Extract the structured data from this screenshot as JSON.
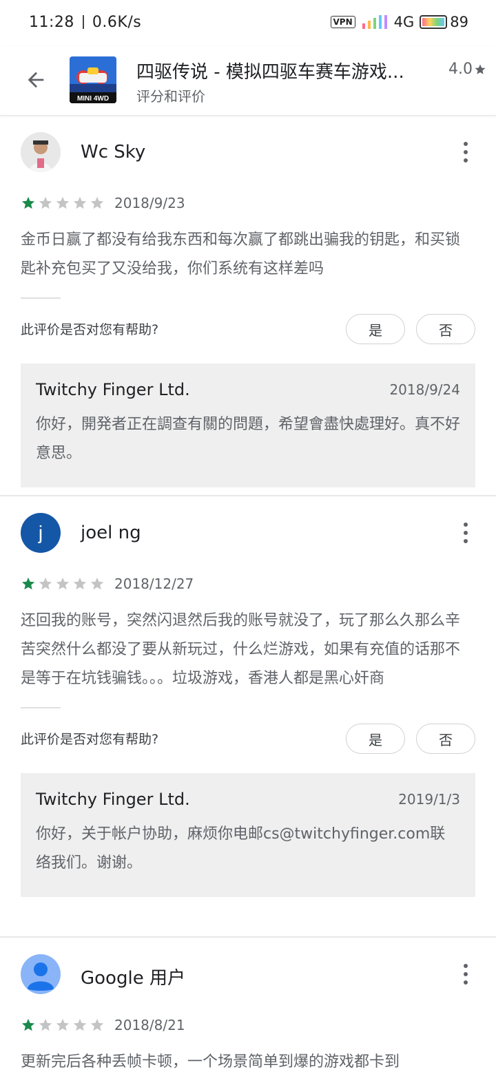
{
  "status_bar": {
    "time": "11:28",
    "speed": "0.6K/s",
    "vpn": "VPN",
    "network": "4G",
    "battery": "89"
  },
  "header": {
    "back_icon": "arrow-left-icon",
    "app_title": "四驱传说 - 模拟四驱车赛车游戏...",
    "subtitle": "评分和评价",
    "rating": "4.0",
    "icon_text": "MINI 4WD"
  },
  "colors": {
    "star_filled": "#1a8a4b",
    "star_empty": "#c4c4c4",
    "dev_reply_bg": "#efefef"
  },
  "reviews": [
    {
      "name": "Wc Sky",
      "avatar": "photo",
      "stars": 1,
      "date": "2018/9/23",
      "text": "金币日赢了都没有给我东西和每次赢了都跳出骗我的钥匙，和买锁匙补充包买了又没给我，你们系统有这样差吗",
      "helpful_label": "此评价是否对您有帮助?",
      "yes_label": "是",
      "no_label": "否",
      "reply": {
        "developer": "Twitchy Finger Ltd.",
        "date": "2018/9/24",
        "text": "你好，開発者正在調查有關的問題，希望會盡快處理好。真不好意思。"
      }
    },
    {
      "name": "joel ng",
      "avatar": "j",
      "stars": 1,
      "date": "2018/12/27",
      "text": "还回我的账号，突然闪退然后我的账号就没了，玩了那么久那么辛苦突然什么都没了要从新玩过，什么烂游戏，如果有充值的话那不是等于在坑钱骗钱。。。垃圾游戏，香港人都是黑心奸商",
      "helpful_label": "此评价是否对您有帮助?",
      "yes_label": "是",
      "no_label": "否",
      "reply": {
        "developer": "Twitchy Finger Ltd.",
        "date": "2019/1/3",
        "text": "你好，关于帐户协助，麻烦你电邮cs@twitchyfinger.com联络我们。谢谢。"
      }
    },
    {
      "name": "Google 用户",
      "avatar": "person-icon",
      "stars": 1,
      "date": "2018/8/21",
      "text": "更新完后各种丢帧卡顿，一个场景简单到爆的游戏都卡到"
    }
  ]
}
